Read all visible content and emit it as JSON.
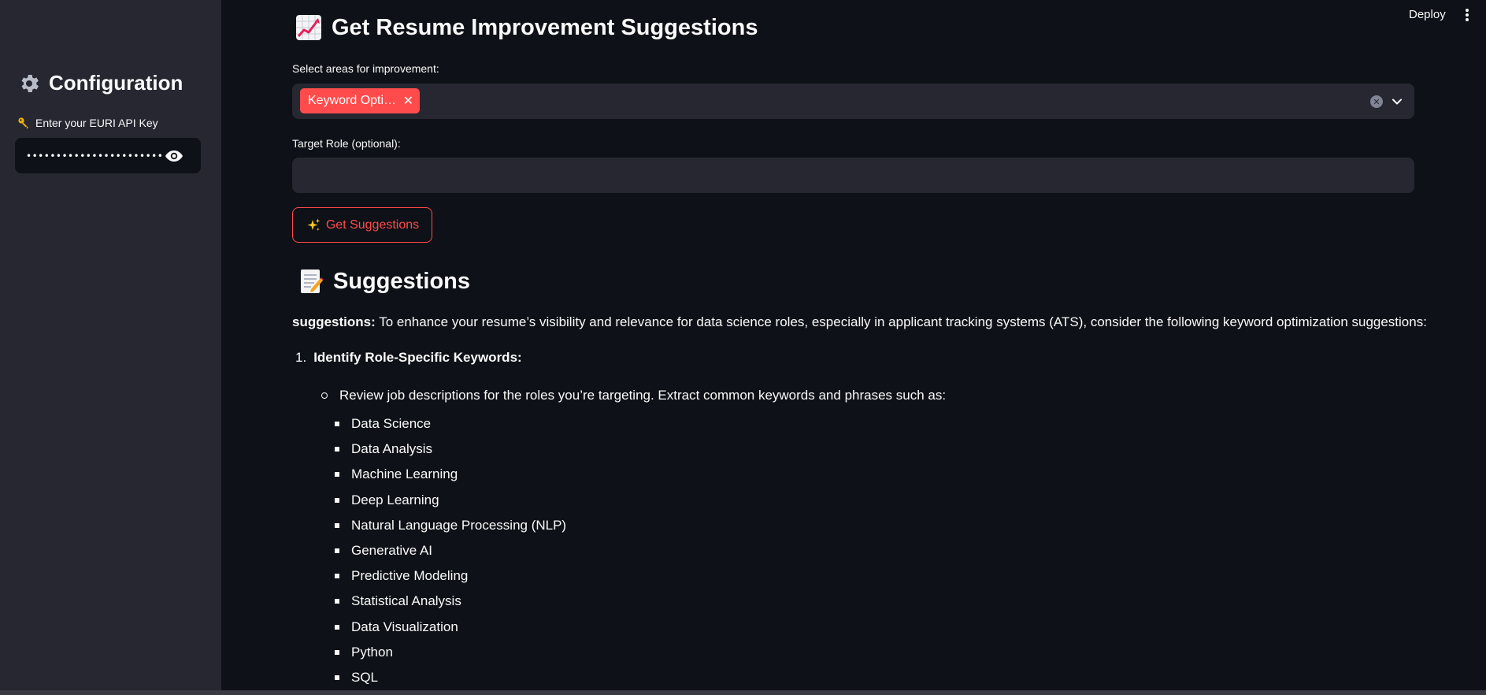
{
  "sidebar": {
    "title": "Configuration",
    "api_key_label": "Enter your EURI API Key",
    "api_key_masked": "••••••••••••••••••••••••••••••••••••",
    "icons": {
      "title": "gear-icon",
      "label": "key-icon",
      "toggle": "eye-icon"
    }
  },
  "toolbar": {
    "deploy_label": "Deploy",
    "menu_icon": "kebab-menu-icon"
  },
  "main": {
    "title": "Get Resume Improvement Suggestions",
    "title_icon": "chart-increasing-icon",
    "areas_label": "Select areas for improvement:",
    "selected_areas": [
      "Keyword Optimi…"
    ],
    "target_role_label": "Target Role (optional):",
    "target_role_value": "",
    "button_label": "Get Suggestions",
    "button_icon": "sparkles-icon"
  },
  "suggestions": {
    "heading": "Suggestions",
    "heading_icon": "memo-icon",
    "intro_bold": "suggestions:",
    "intro_text": " To enhance your resume’s visibility and relevance for data science roles, especially in applicant tracking systems (ATS), consider the following keyword optimization suggestions:",
    "items": [
      {
        "number": "1.",
        "title": "Identify Role-Specific Keywords:",
        "sub": "Review job descriptions for the roles you’re targeting. Extract common keywords and phrases such as:",
        "keywords": [
          "Data Science",
          "Data Analysis",
          "Machine Learning",
          "Deep Learning",
          "Natural Language Processing (NLP)",
          "Generative AI",
          "Predictive Modeling",
          "Statistical Analysis",
          "Data Visualization",
          "Python",
          "SQL"
        ]
      }
    ]
  },
  "colors": {
    "accent": "#ff4b4b",
    "background": "#0e1117",
    "surface": "#262730",
    "text": "#fafafa"
  }
}
